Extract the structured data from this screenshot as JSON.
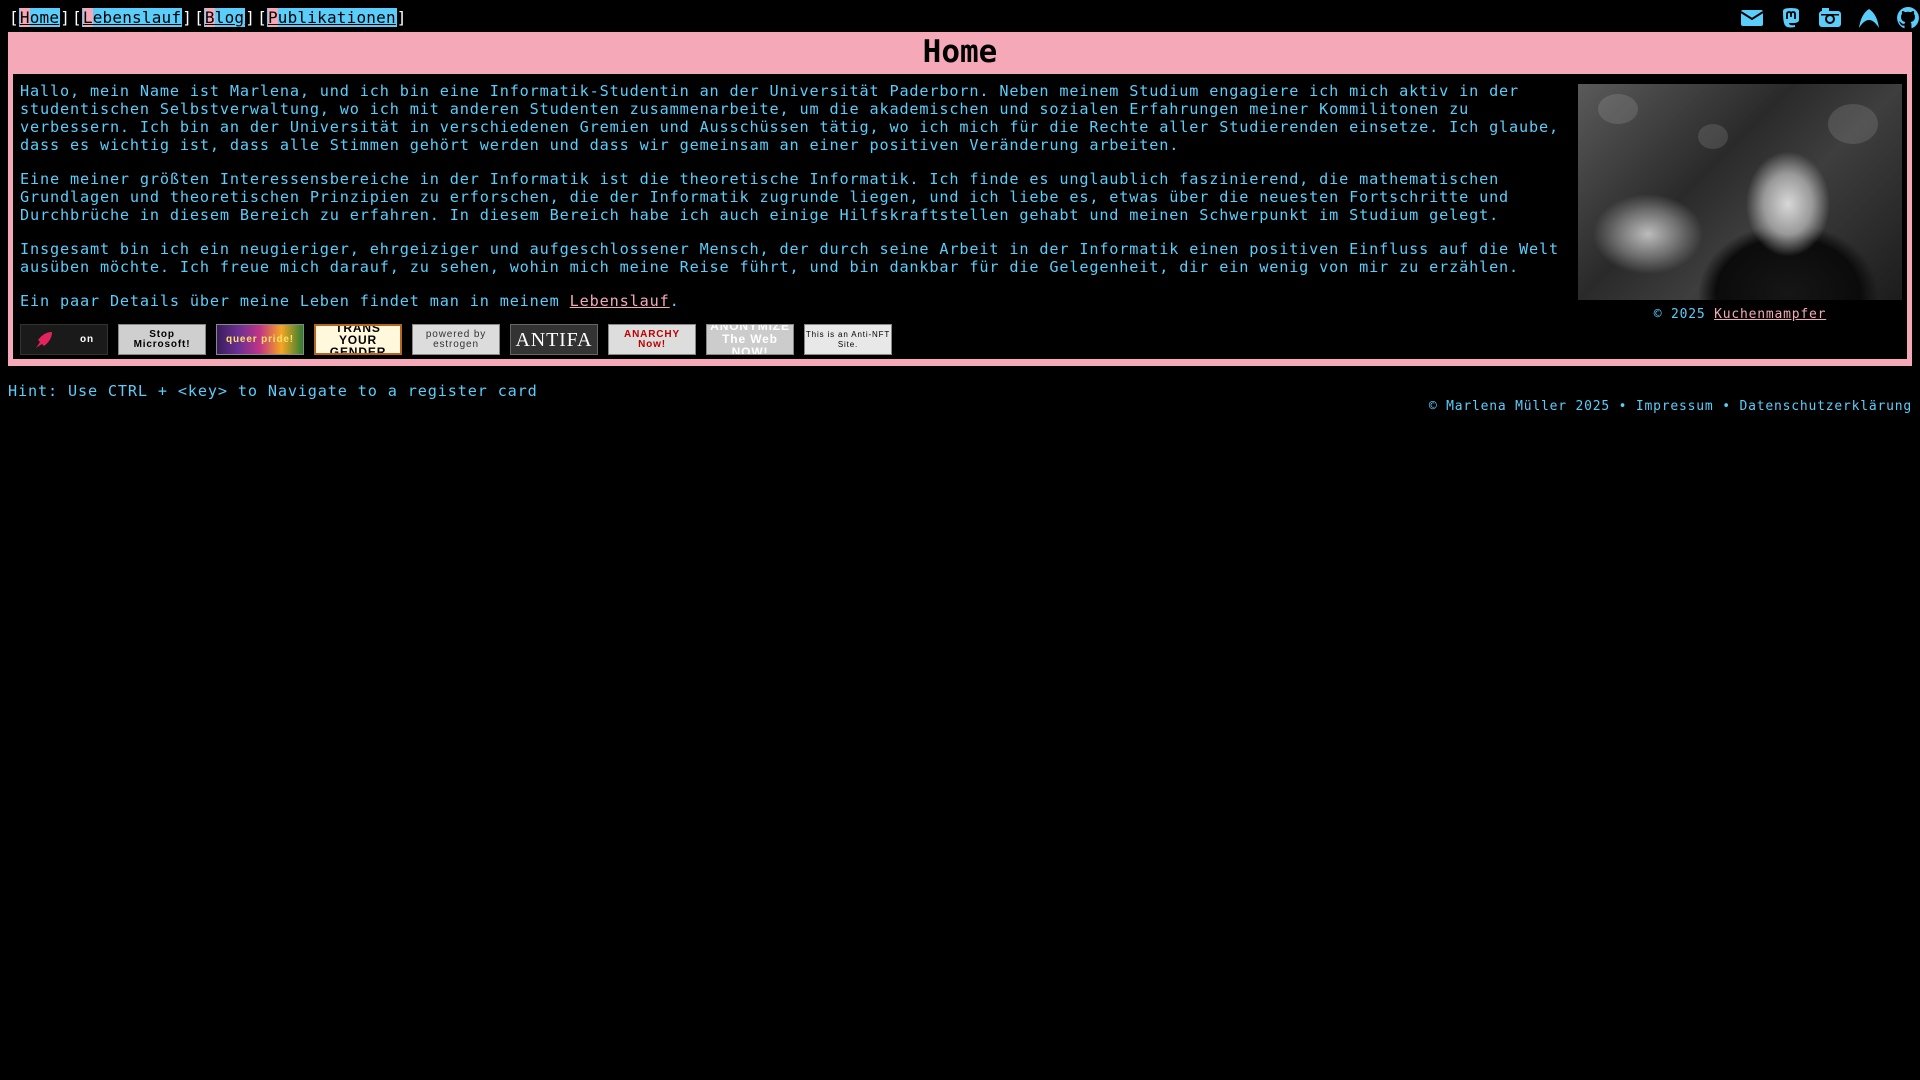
{
  "nav": {
    "items": [
      {
        "hotkey": "H",
        "rest": "ome"
      },
      {
        "hotkey": "L",
        "rest": "ebenslauf"
      },
      {
        "hotkey": "B",
        "rest": "log"
      },
      {
        "hotkey": "P",
        "rest": "ublikationen"
      }
    ],
    "icons": [
      "envelope-icon",
      "mastodon-icon",
      "camera-icon",
      "arch-icon",
      "github-icon"
    ]
  },
  "card": {
    "title": "Home",
    "paragraphs": [
      "Hallo, mein Name ist Marlena, und ich bin eine Informatik-Studentin an der Universität Paderborn. Neben meinem Studium engagiere ich mich aktiv in der studentischen Selbstverwaltung, wo ich mit anderen Studenten zusammenarbeite, um die akademischen und sozialen Erfahrungen meiner Kommilitonen zu verbessern. Ich bin an der Universität in verschiedenen Gremien und Ausschüssen tätig, wo ich mich für die Rechte aller Studierenden einsetze. Ich glaube, dass es wichtig ist, dass alle Stimmen gehört werden und dass wir gemeinsam an einer positiven Veränderung arbeiten.",
      "Eine meiner größten Interessensbereiche in der Informatik ist die theoretische Informatik. Ich finde es unglaublich faszinierend, die mathematischen Grundlagen und theoretischen Prinzipien zu erforschen, die der Informatik zugrunde liegen, und ich liebe es, etwas über die neuesten Fortschritte und Durchbrüche in diesem Bereich zu erfahren. In diesem Bereich habe ich auch einige Hilfskraftstellen gehabt und meinen Schwerpunkt im Studium gelegt.",
      "Insgesamt bin ich ein neugieriger, ehrgeiziger und aufgeschlossener Mensch, der durch seine Arbeit in der Informatik einen positiven Einfluss auf die Welt ausüben möchte. Ich freue mich darauf, zu sehen, wohin mich meine Reise führt, und bin dankbar für die Gelegenheit, dir ein wenig von mir zu erzählen."
    ],
    "last_paragraph_prefix": "Ein paar Details über meine Leben findet man in meinem ",
    "last_paragraph_link": "Lebenslauf",
    "last_paragraph_suffix": ".",
    "badges": [
      {
        "name": "rocket-on-badge",
        "text": "on"
      },
      {
        "name": "stop-microsoft-badge",
        "text": "Stop Microsoft!"
      },
      {
        "name": "queer-pride-badge",
        "text": "queer pride!"
      },
      {
        "name": "trans-your-gender-badge",
        "text": "TRANS YOUR GENDER"
      },
      {
        "name": "powered-by-estrogen-badge",
        "text": "powered by estrogen"
      },
      {
        "name": "antifa-badge",
        "text": "ANTIFA"
      },
      {
        "name": "anarchy-now-badge",
        "text": "ANARCHY Now!"
      },
      {
        "name": "anonymize-badge",
        "text": "ANONYMIZE The Web NOW!"
      },
      {
        "name": "anti-nft-badge",
        "text": "This is an Anti-NFT Site."
      }
    ],
    "photo_caption_prefix": "© 2025 ",
    "photo_caption_link": "Kuchenmampfer"
  },
  "hint": "Hint: Use CTRL + <key> to Navigate to a register card",
  "footer": {
    "copyright": "© Marlena Müller 2025",
    "sep": " • ",
    "impressum": "Impressum",
    "privacy": "Datenschutzerklärung"
  },
  "colors": {
    "trans_blue": "#5bcdfa",
    "trans_pink": "#f5a9b8",
    "background": "#000000"
  }
}
